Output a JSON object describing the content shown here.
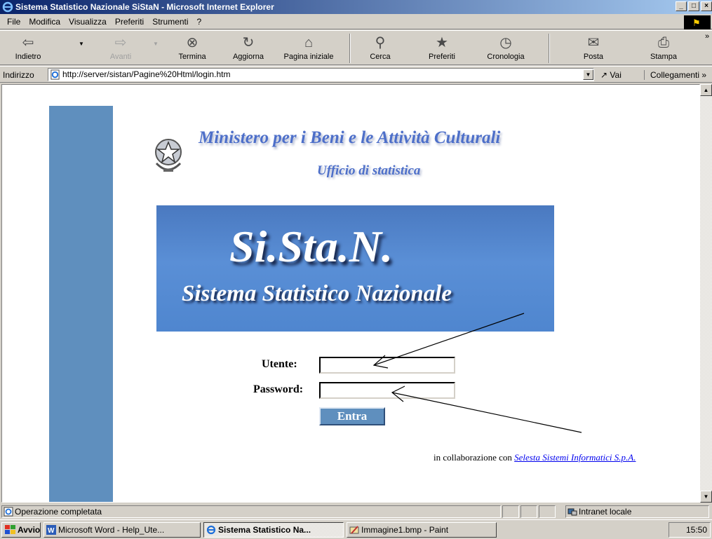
{
  "window": {
    "title": "Sistema Statistico Nazionale SiStaN - Microsoft Internet Explorer",
    "controls": [
      "_",
      "□",
      "×"
    ]
  },
  "menu": {
    "items": [
      "File",
      "Modifica",
      "Visualizza",
      "Preferiti",
      "Strumenti",
      "?"
    ]
  },
  "toolbar": {
    "buttons": [
      {
        "label": "Indietro",
        "icon": "back-arrow-icon",
        "enabled": true
      },
      {
        "label": "Avanti",
        "icon": "forward-arrow-icon",
        "enabled": false
      },
      {
        "label": "Termina",
        "icon": "stop-icon",
        "enabled": true
      },
      {
        "label": "Aggiorna",
        "icon": "refresh-icon",
        "enabled": true
      },
      {
        "label": "Pagina iniziale",
        "icon": "home-icon",
        "enabled": true
      },
      {
        "label": "Cerca",
        "icon": "search-icon",
        "enabled": true
      },
      {
        "label": "Preferiti",
        "icon": "favorites-icon",
        "enabled": true
      },
      {
        "label": "Cronologia",
        "icon": "history-icon",
        "enabled": true
      },
      {
        "label": "Posta",
        "icon": "mail-icon",
        "enabled": true
      },
      {
        "label": "Stampa",
        "icon": "print-icon",
        "enabled": true
      }
    ],
    "more": "»"
  },
  "address": {
    "label": "Indirizzo",
    "url": "http://server/sistan/Pagine%20Html/login.htm",
    "go_label": "Vai",
    "links_label": "Collegamenti"
  },
  "page": {
    "ministry": "Ministero per i Beni e le Attività Culturali",
    "office": "Ufficio di statistica",
    "banner_title": "Si.Sta.N.",
    "banner_subtitle": "Sistema Statistico Nazionale",
    "user_label": "Utente:",
    "user_value": "",
    "password_label": "Password:",
    "password_value": "",
    "submit_label": "Entra",
    "collab_text": "in collaborazione con",
    "collab_link": "Selesta Sistemi Informatici S.p.A."
  },
  "status": {
    "text": "Operazione completata",
    "zone": "Intranet locale"
  },
  "taskbar": {
    "start_label": "Avvio",
    "tasks": [
      {
        "label": "Microsoft Word - Help_Ute...",
        "active": false
      },
      {
        "label": "Sistema Statistico Na...",
        "active": true
      },
      {
        "label": "Immagine1.bmp - Paint",
        "active": false
      }
    ],
    "clock": "15:50"
  },
  "colors": {
    "title_bar": "#0a246a",
    "ministry_text": "#4d6fc9",
    "side_bar": "#5f8fbe",
    "banner": "#4f86cf",
    "link": "#0000ee"
  }
}
